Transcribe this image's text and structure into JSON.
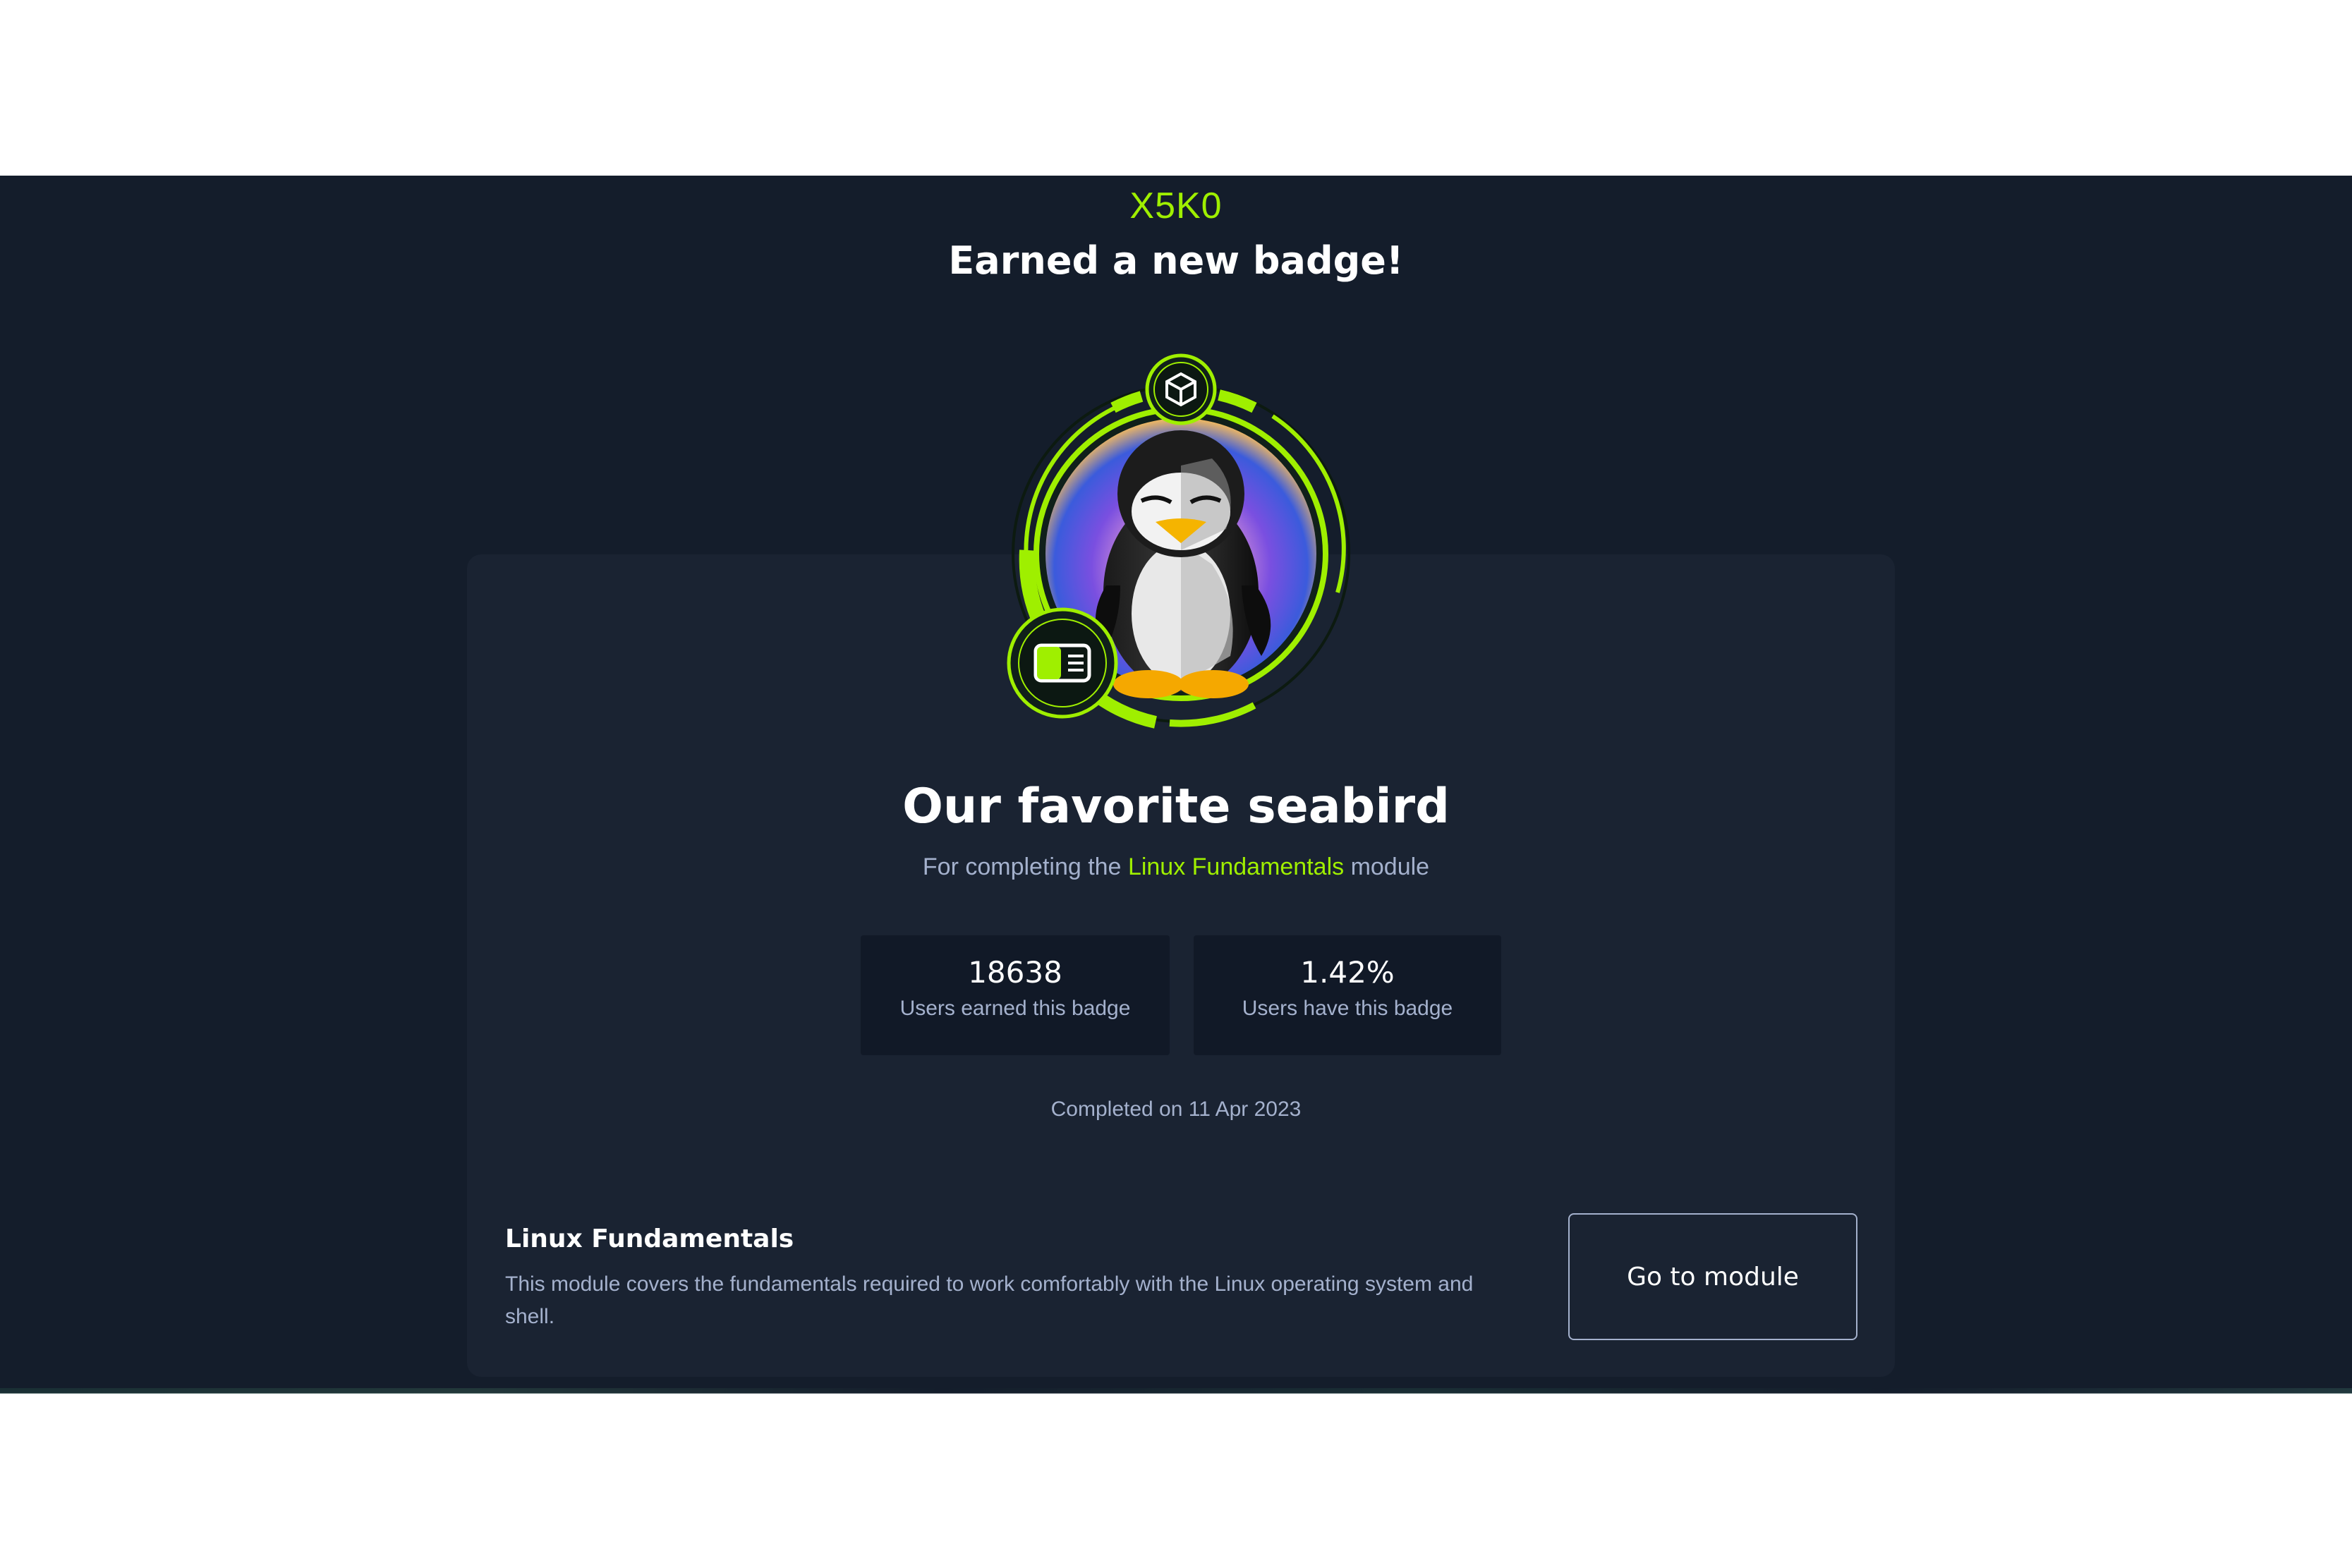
{
  "header": {
    "username": "X5K0",
    "headline": "Earned a new badge!"
  },
  "badge": {
    "title": "Our favorite seabird",
    "subtitle_prefix": "For completing the",
    "module_link": "Linux Fundamentals",
    "subtitle_suffix": "module",
    "image_icon": "penguin-badge-icon"
  },
  "stats": [
    {
      "value": "18638",
      "label": "Users earned this badge"
    },
    {
      "value": "1.42%",
      "label": "Users have this badge"
    }
  ],
  "completed": "Completed on 11 Apr 2023",
  "module": {
    "name": "Linux Fundamentals",
    "description": "This module covers the fundamentals required to work comfortably with the Linux operating system and shell.",
    "button_label": "Go to module"
  },
  "colors": {
    "background": "#141d2b",
    "card": "#1a2332",
    "accent": "#9fef00",
    "muted_text": "#a4b1cd"
  }
}
